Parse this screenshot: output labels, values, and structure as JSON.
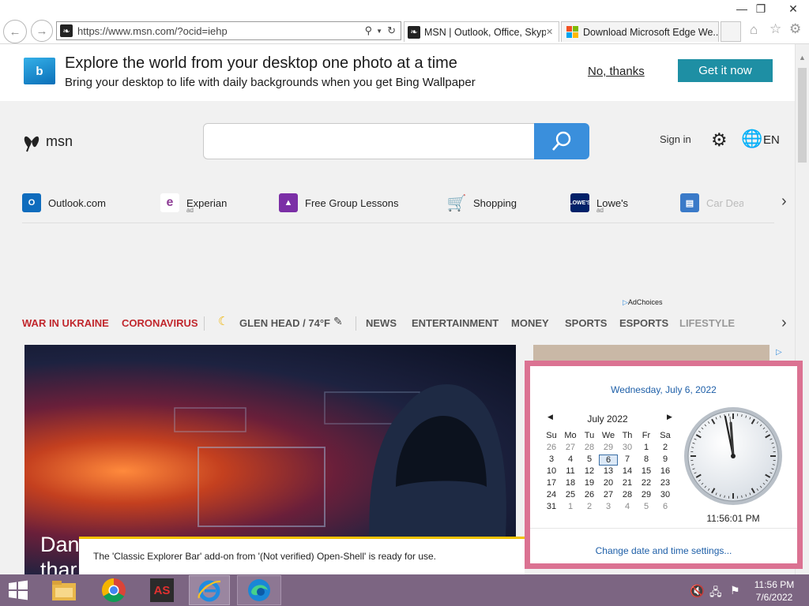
{
  "browser": {
    "address_url": "https://www.msn.com/?ocid=iehp",
    "tabs": [
      {
        "label": "MSN | Outlook, Office, Skyp..."
      },
      {
        "label": "Download Microsoft Edge We..."
      }
    ]
  },
  "banner": {
    "title": "Explore the world from your desktop one photo at a time",
    "subtitle": "Bring your desktop to life with daily backgrounds when you get Bing Wallpaper",
    "decline_label": "No, thanks",
    "accept_label": "Get it now"
  },
  "msn": {
    "logo_text": "msn",
    "search_placeholder": "",
    "sign_in": "Sign in",
    "language": "EN"
  },
  "quick_links": [
    {
      "label": "Outlook.com",
      "sub": ""
    },
    {
      "label": "Experian",
      "sub": "ad"
    },
    {
      "label": "Free Group Lessons",
      "sub": ""
    },
    {
      "label": "Shopping",
      "sub": ""
    },
    {
      "label": "Lowe's",
      "sub": "ad"
    },
    {
      "label": "Car Deal",
      "sub": ""
    }
  ],
  "adchoices": "AdChoices",
  "nav": {
    "war": "WAR IN UKRAINE",
    "corona": "CORONAVIRUS",
    "weather": "GLEN HEAD / 74°F",
    "items": [
      "NEWS",
      "ENTERTAINMENT",
      "MONEY",
      "SPORTS",
      "ESPORTS",
      "LIFESTYLE"
    ]
  },
  "hero_headline": "Dan\nthar",
  "notification": "The 'Classic Explorer Bar' add-on from '(Not verified) Open-Shell' is ready for use.",
  "calendar": {
    "date_long": "Wednesday, July 6, 2022",
    "month_label": "July 2022",
    "weekdays": [
      "Su",
      "Mo",
      "Tu",
      "We",
      "Th",
      "Fr",
      "Sa"
    ],
    "weeks": [
      [
        "26",
        "27",
        "28",
        "29",
        "30",
        "1",
        "2"
      ],
      [
        "3",
        "4",
        "5",
        "6",
        "7",
        "8",
        "9"
      ],
      [
        "10",
        "11",
        "12",
        "13",
        "14",
        "15",
        "16"
      ],
      [
        "17",
        "18",
        "19",
        "20",
        "21",
        "22",
        "23"
      ],
      [
        "24",
        "25",
        "26",
        "27",
        "28",
        "29",
        "30"
      ],
      [
        "31",
        "1",
        "2",
        "3",
        "4",
        "5",
        "6"
      ]
    ],
    "selected_day": "6",
    "time": "11:56:01 PM",
    "settings_link": "Change date and time settings..."
  },
  "taskbar": {
    "time": "11:56 PM",
    "date": "7/6/2022"
  },
  "colors": {
    "accent_blue": "#3a8fdc",
    "teal_button": "#1e8fa4",
    "nav_red": "#c1272d",
    "calendar_frame": "#db7292",
    "taskbar": "#7c6582"
  }
}
